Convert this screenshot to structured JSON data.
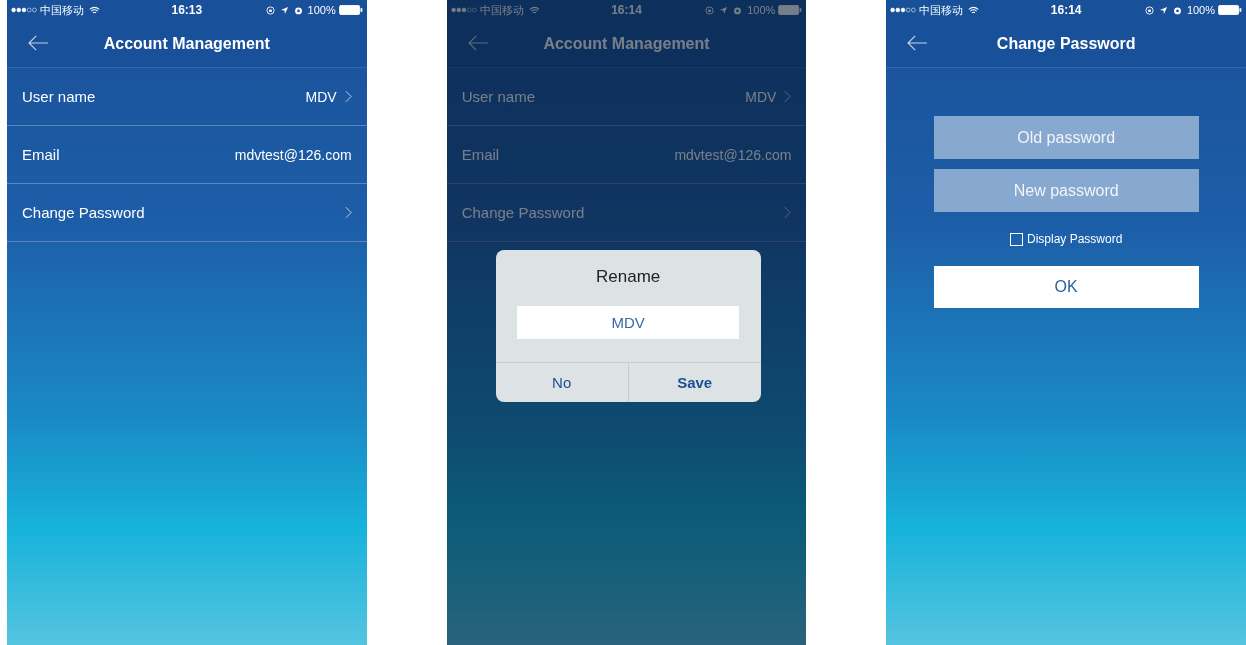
{
  "screens": [
    {
      "kind": "list",
      "dimmed": false,
      "status_bar": {
        "carrier": "中国移动",
        "time": "16:13",
        "battery": "100%"
      },
      "title": "Account Management",
      "rows": [
        {
          "label": "User name",
          "value": "MDV",
          "chevron": true
        },
        {
          "label": "Email",
          "value": "mdvtest@126.com",
          "chevron": false
        },
        {
          "label": "Change Password",
          "chevron": true
        }
      ]
    },
    {
      "kind": "list",
      "dimmed": true,
      "status_bar": {
        "carrier": "中国移动",
        "time": "16:14",
        "battery": "100%"
      },
      "title": "Account Management",
      "rows": [
        {
          "label": "User name",
          "value": "MDV",
          "chevron": true
        },
        {
          "label": "Email",
          "value": "mdvtest@126.com",
          "chevron": false
        },
        {
          "label": "Change Password",
          "chevron": true
        }
      ],
      "dialog": {
        "title": "Rename",
        "value": "MDV",
        "buttons": [
          "No",
          "Save"
        ]
      }
    },
    {
      "kind": "form",
      "dimmed": false,
      "status_bar": {
        "carrier": "中国移动",
        "time": "16:14",
        "battery": "100%"
      },
      "title": "Change Password",
      "fields": [
        {
          "placeholder": "Old password"
        },
        {
          "placeholder": "New password"
        }
      ],
      "checkbox": {
        "label": "Display Password",
        "checked": false
      },
      "button": "OK"
    }
  ]
}
